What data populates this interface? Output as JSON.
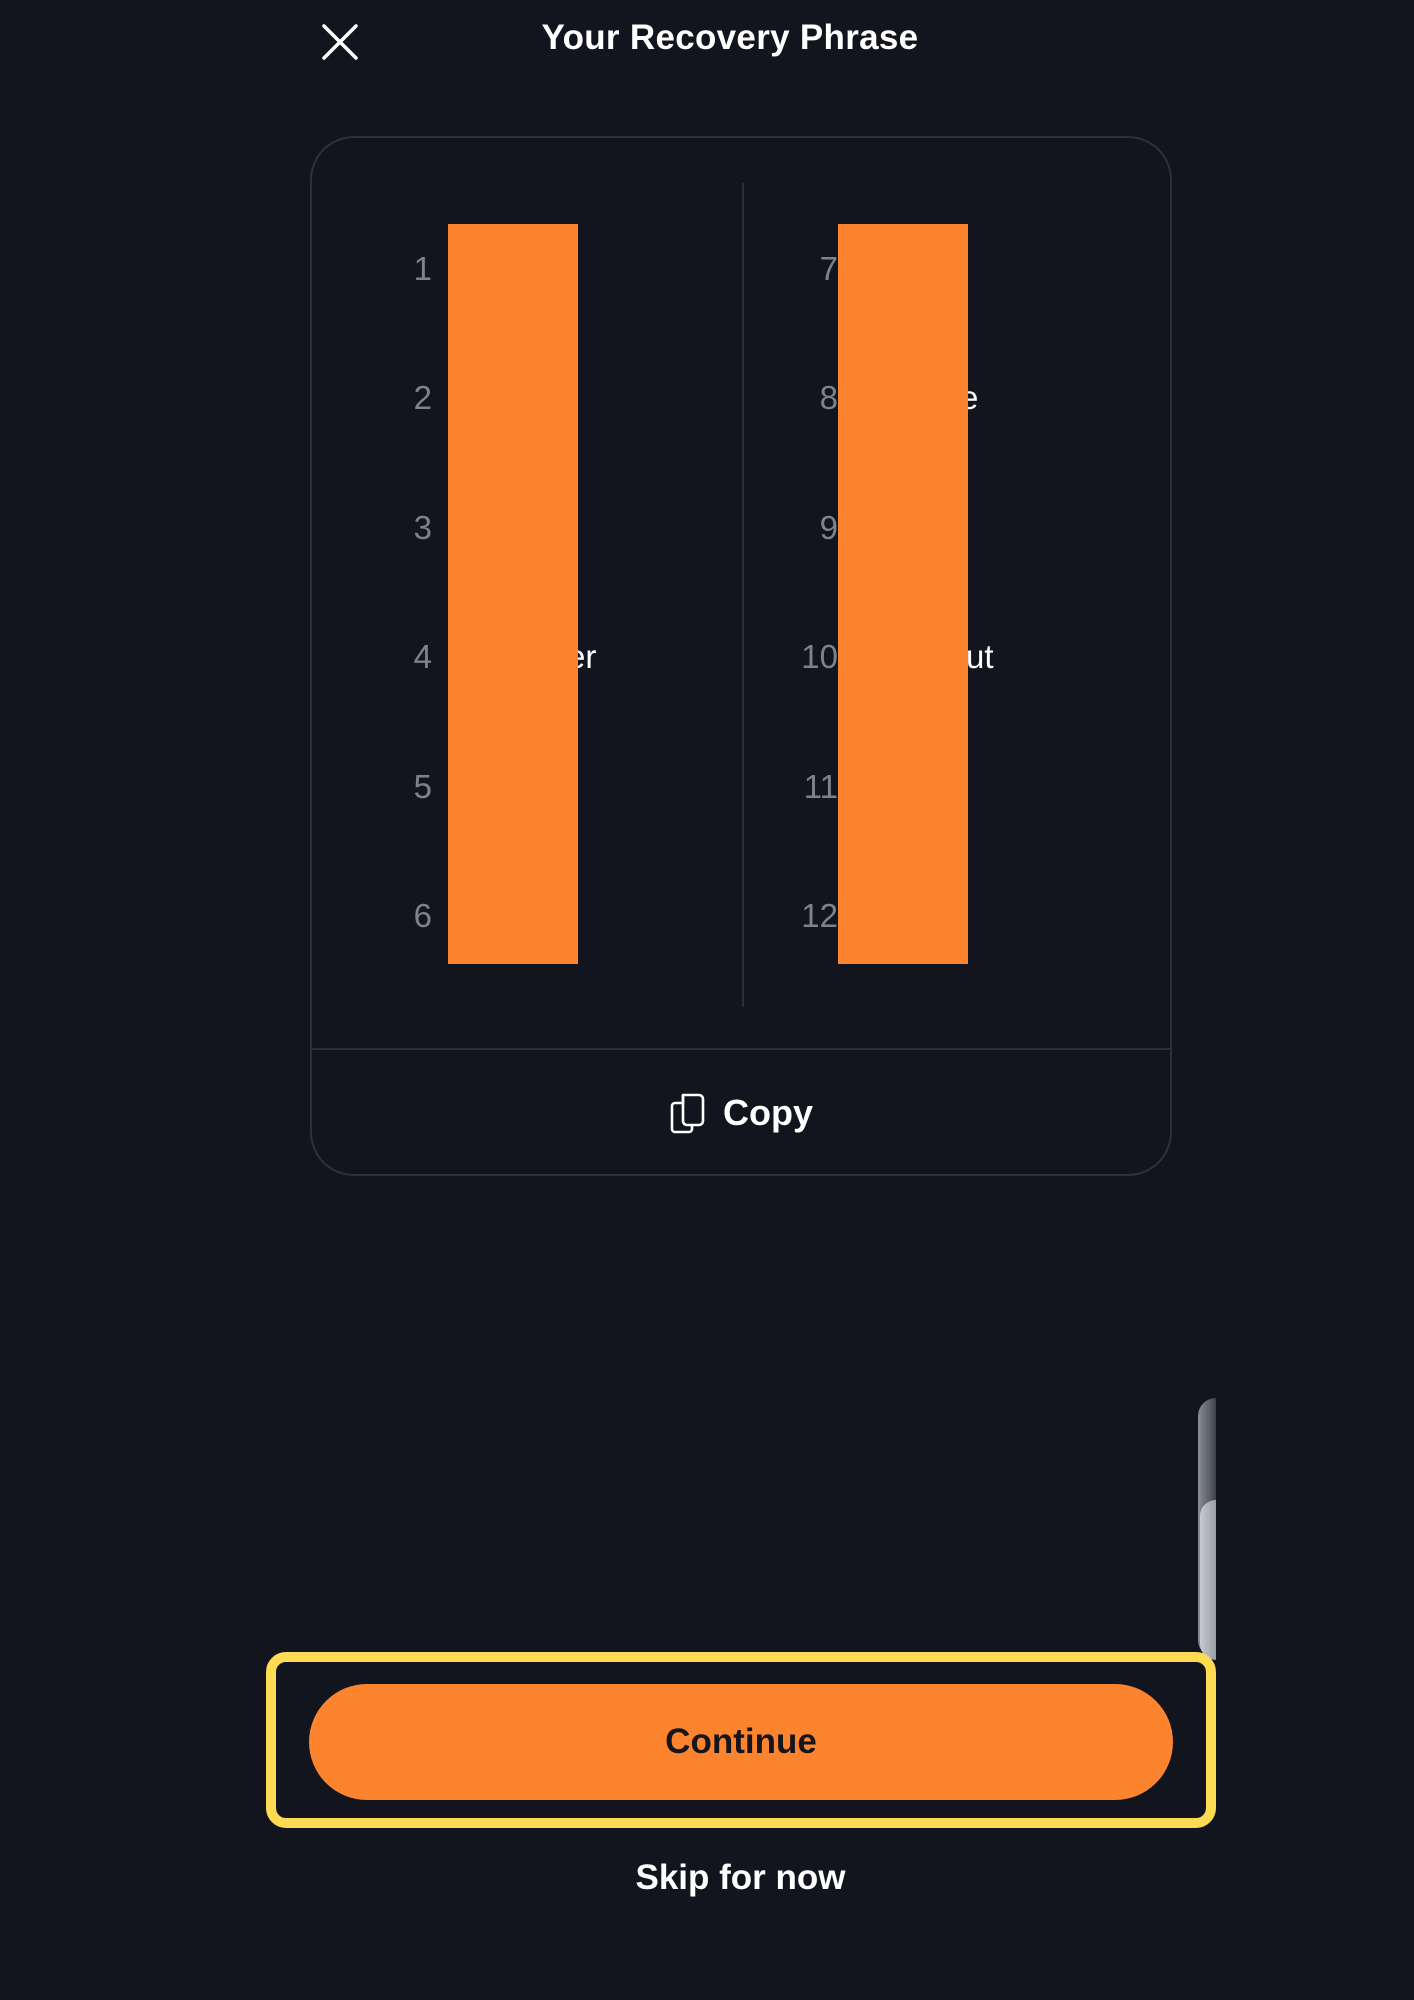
{
  "header": {
    "title": "Your Recovery Phrase",
    "close_icon": "close-icon"
  },
  "phrase": {
    "left_column": [
      {
        "number": "1",
        "word": ""
      },
      {
        "number": "2",
        "word": ""
      },
      {
        "number": "3",
        "word": ""
      },
      {
        "number": "4",
        "word": "er"
      },
      {
        "number": "5",
        "word": ""
      },
      {
        "number": "6",
        "word": ""
      }
    ],
    "right_column": [
      {
        "number": "7",
        "word": ""
      },
      {
        "number": "8",
        "word": "e"
      },
      {
        "number": "9",
        "word": ""
      },
      {
        "number": "10",
        "word": "ut"
      },
      {
        "number": "11",
        "word": ""
      },
      {
        "number": "12",
        "word": ""
      }
    ],
    "redaction_color": "#fd842e"
  },
  "copy": {
    "label": "Copy",
    "icon": "copy-icon"
  },
  "actions": {
    "continue_label": "Continue",
    "skip_label": "Skip for now"
  },
  "colors": {
    "background": "#12151d",
    "accent": "#fd842e",
    "highlight": "#fedb52",
    "muted_text": "#7d828c"
  }
}
